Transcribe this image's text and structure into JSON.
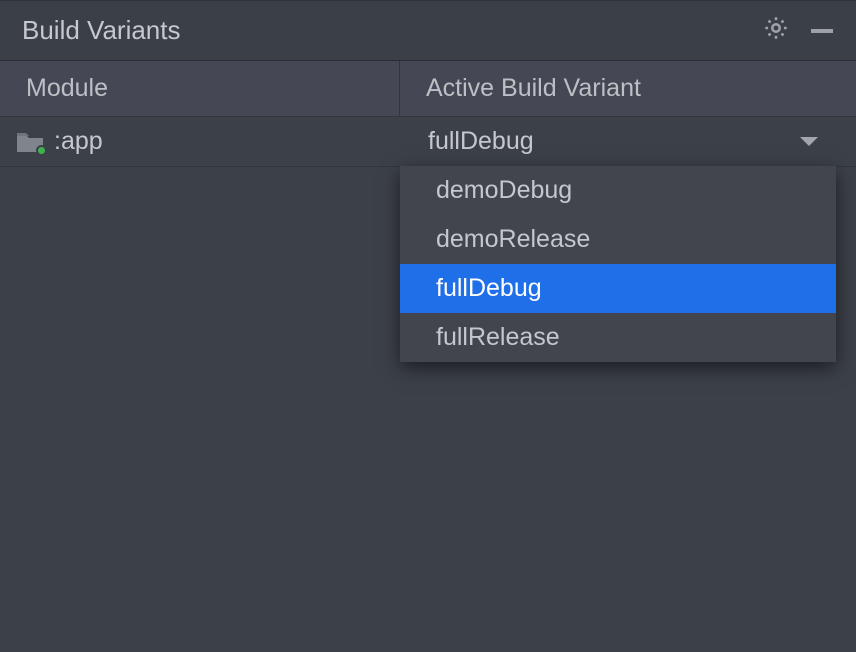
{
  "panel": {
    "title": "Build Variants"
  },
  "headers": {
    "module": "Module",
    "variant": "Active Build Variant"
  },
  "rows": [
    {
      "module": ":app",
      "variant": "fullDebug"
    }
  ],
  "dropdown": {
    "options": [
      {
        "label": "demoDebug"
      },
      {
        "label": "demoRelease"
      },
      {
        "label": "fullDebug"
      },
      {
        "label": "fullRelease"
      }
    ],
    "selected": "fullDebug"
  },
  "icons": {
    "settings": "gear-icon",
    "minimize": "minimize-icon",
    "folder": "folder-icon",
    "chevron": "chevron-down-icon"
  }
}
